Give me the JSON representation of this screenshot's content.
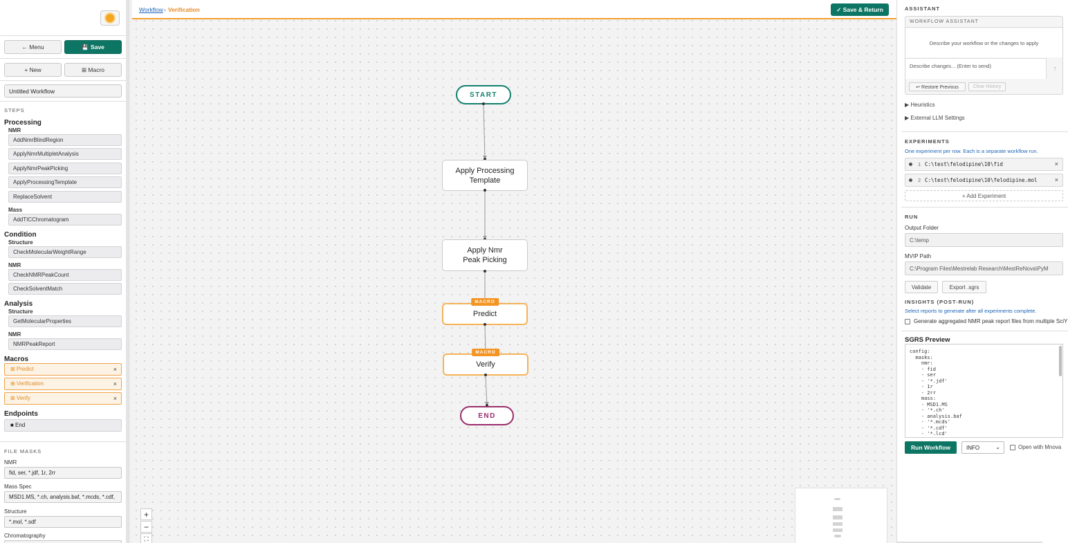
{
  "sidebar": {
    "menu_label": "← Menu",
    "save_label": "Save",
    "new_label": "+ New",
    "macro_label": "⊞ Macro",
    "workflow_name": "Untitled Workflow",
    "steps_header": "STEPS",
    "processing": {
      "title": "Processing",
      "nmr_label": "NMR",
      "nmr_steps": [
        "AddNmrBlindRegion",
        "ApplyNmrMultipletAnalysis",
        "ApplyNmrPeakPicking",
        "ApplyProcessingTemplate",
        "ReplaceSolvent"
      ],
      "mass_label": "Mass",
      "mass_steps": [
        "AddTICChromatogram"
      ]
    },
    "condition": {
      "title": "Condition",
      "structure_label": "Structure",
      "structure_steps": [
        "CheckMolecularWeightRange"
      ],
      "nmr_label": "NMR",
      "nmr_steps": [
        "CheckNMRPeakCount",
        "CheckSolventMatch"
      ]
    },
    "analysis": {
      "title": "Analysis",
      "structure_label": "Structure",
      "structure_steps": [
        "GetMolecularProperties"
      ],
      "nmr_label": "NMR",
      "nmr_steps": [
        "NMRPeakReport"
      ]
    },
    "macros": {
      "title": "Macros",
      "items": [
        "⊞ Predict",
        "⊞ Verification",
        "⊞ Verify"
      ],
      "remove": "×"
    },
    "endpoints": {
      "title": "Endpoints",
      "end_label": "■ End"
    },
    "file_masks": {
      "header": "FILE MASKS",
      "nmr_label": "NMR",
      "nmr_value": "fid, ser, *.jdf, 1r, 2rr",
      "mass_label": "Mass Spec",
      "mass_value": "MSD1.MS, *.ch, analysis.baf, *.mcds, *.cdf,",
      "structure_label": "Structure",
      "structure_value": "*.mol, *.sdf",
      "chrom_label": "Chromatography"
    }
  },
  "breadcrumb": {
    "workflow": "Workflow",
    "separator": "›",
    "current": "Verification"
  },
  "save_return_label": "✓ Save & Return",
  "flow": {
    "start": "START",
    "nodes": [
      "Apply Processing\nTemplate",
      "Apply Nmr\nPeak Picking"
    ],
    "macro_tag": "MACRO",
    "macro_nodes": [
      "Predict",
      "Verify"
    ],
    "end": "END"
  },
  "zoom": {
    "in": "+",
    "out": "−",
    "fit": "⛶"
  },
  "assistant": {
    "header": "ASSISTANT",
    "box_title": "WORKFLOW ASSISTANT",
    "message": "Describe your workflow or the changes to apply",
    "input_placeholder": "Describe changes... (Enter to send)",
    "send": "↑",
    "restore_label": "↩ Restore Previous",
    "clear_label": "Clear History",
    "heuristics": "▶ Heuristics",
    "llm_settings": "▶ External LLM Settings"
  },
  "experiments": {
    "header": "EXPERIMENTS",
    "note": "One experiment per row. Each is a separate workflow run.",
    "rows": [
      {
        "num": "1",
        "path": "C:\\test\\felodipine\\10\\fid"
      },
      {
        "num": "2",
        "path": "C:\\test\\felodipine\\10\\felodipine.mol"
      }
    ],
    "remove": "×",
    "add_label": "+ Add Experiment"
  },
  "run": {
    "header": "RUN",
    "output_label": "Output Folder",
    "output_value": "C:\\temp",
    "mvip_label": "MVIP Path",
    "mvip_value": "C:\\Program Files\\Mestrelab Research\\MestReNova\\PyM",
    "validate_label": "Validate",
    "export_label": "Export .sgrs",
    "insights_header": "INSIGHTS (POST-RUN)",
    "insights_note": "Select reports to generate after all experiments complete.",
    "insights_checkbox": "Generate aggregated NMR peak report files from multiple SciY",
    "sgrs_title": "SGRS Preview",
    "sgrs_text": "config:\n  masks:\n    nmr:\n    - fid\n    - ser\n    - '*.jdf'\n    - 1r\n    - 2rr\n    mass:\n    - MSD1.MS\n    - '*.ch'\n    - analysis.baf\n    - '*.mcds'\n    - '*.cdf'\n    - '*.lcd'",
    "run_label": "Run Workflow",
    "level_value": "INFO",
    "level_arrow": "⌄",
    "open_mnova_label": "Open with Mnova"
  }
}
